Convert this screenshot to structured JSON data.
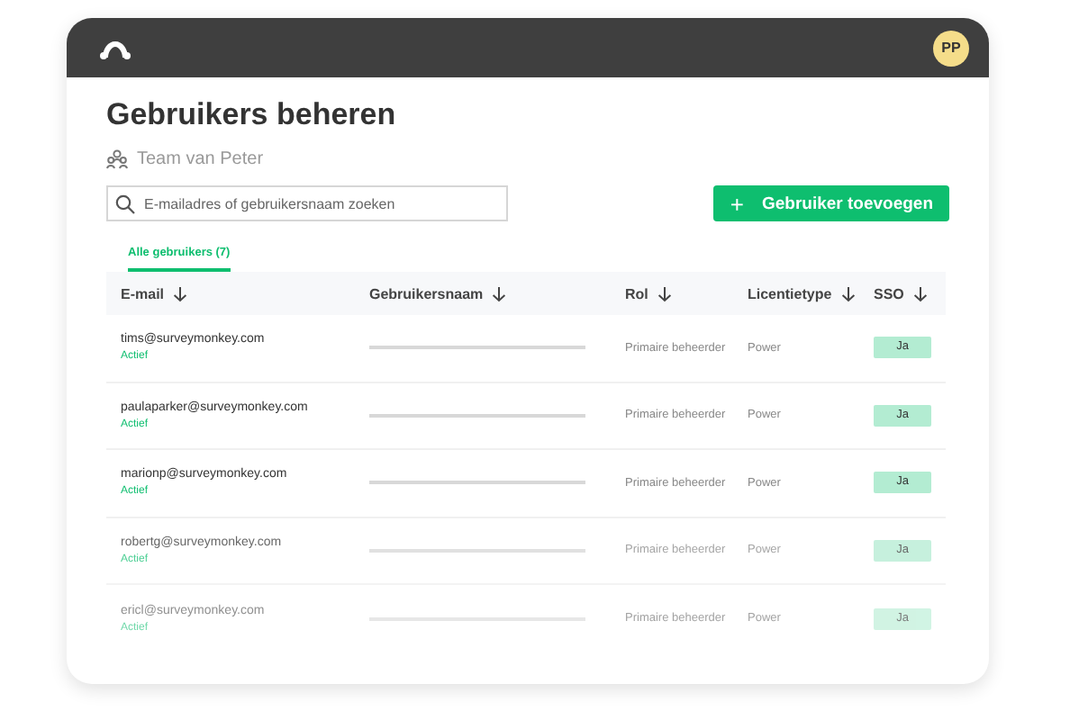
{
  "header": {
    "avatar": "PP"
  },
  "title": "Gebruikers beheren",
  "team": "Team van Peter",
  "search": {
    "placeholder": "E-mailadres of gebruikersnaam zoeken"
  },
  "add_button": {
    "icon": "+",
    "label": "Gebruiker toevoegen"
  },
  "tabs": [
    {
      "label": "Alle gebruikers (7)",
      "selected": true
    }
  ],
  "table": {
    "columns": [
      "E-mail",
      "Gebruikersnaam",
      "Rol",
      "Licentietype",
      "SSO"
    ],
    "rows": [
      {
        "email": "tims@surveymonkey.com",
        "status": "Actief",
        "role": "Primaire beheerder",
        "license": "Power",
        "sso": "Ja",
        "kind": "normal"
      },
      {
        "email": "paulaparker@surveymonkey.com",
        "status": "Actief",
        "role": "Primaire beheerder",
        "license": "Power",
        "sso": "Ja",
        "kind": "normal"
      },
      {
        "email": "marionp@surveymonkey.com",
        "status": "Actief",
        "role": "Primaire beheerder",
        "license": "Power",
        "sso": "Ja",
        "kind": "normal"
      },
      {
        "email": "robertg@surveymonkey.com",
        "status": "Actief",
        "role": "Primaire beheerder",
        "license": "Power",
        "sso": "Ja",
        "kind": "faded"
      },
      {
        "email": "ericl@surveymonkey.com",
        "status": "Actief",
        "role": "Primaire beheerder",
        "license": "Power",
        "sso": "Ja",
        "kind": "ghost"
      }
    ]
  }
}
